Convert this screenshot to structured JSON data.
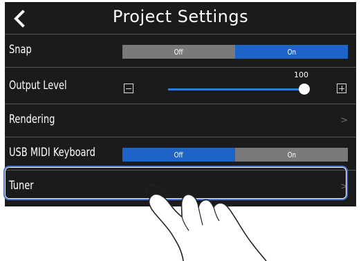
{
  "header": {
    "title": "Project Settings",
    "back_icon": "chevron-left-icon"
  },
  "rows": {
    "snap": {
      "label": "Snap",
      "off_label": "Off",
      "on_label": "On",
      "selected": "On"
    },
    "output_level": {
      "label": "Output Level",
      "value": "100",
      "level_percent": 100
    },
    "rendering": {
      "label": "Rendering",
      "chevron": ">"
    },
    "usb_midi_keyboard": {
      "label": "USB MIDI Keyboard",
      "off_label": "Off",
      "on_label": "On",
      "selected": "Off"
    },
    "tuner": {
      "label": "Tuner",
      "chevron": ">"
    }
  },
  "colors": {
    "background": "#1b1b1b",
    "accent_blue": "#1e64c8",
    "inactive_gray": "#7a7a7a",
    "highlight": "#4d74c9"
  }
}
